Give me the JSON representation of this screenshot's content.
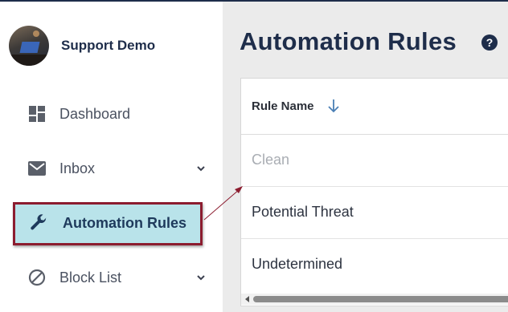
{
  "brand": {
    "name": "Support Demo"
  },
  "sidebar": {
    "items": [
      {
        "label": "Dashboard"
      },
      {
        "label": "Inbox"
      },
      {
        "label": "Automation Rules"
      },
      {
        "label": "Block List"
      }
    ]
  },
  "page": {
    "title": "Automation Rules"
  },
  "table": {
    "header": "Rule Name",
    "rows": [
      "Clean",
      "Potential Threat",
      "Undetermined"
    ]
  },
  "colors": {
    "highlight_border": "#8c1c2f",
    "highlight_fill": "#b9e3ea",
    "navy": "#1e2d4a",
    "sort_arrow": "#4a7fb5"
  },
  "icons": [
    "dashboard-icon",
    "mail-icon",
    "wrench-icon",
    "block-icon",
    "chevron-down-icon",
    "help-icon",
    "sort-arrow-down-icon"
  ]
}
